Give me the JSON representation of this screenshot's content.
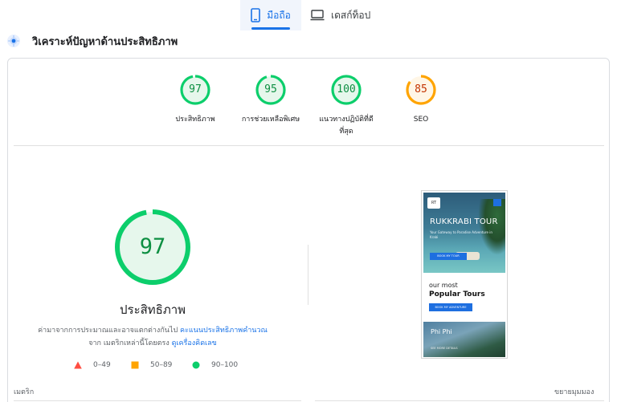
{
  "tabs": {
    "mobile": "มือถือ",
    "desktop": "เดสก์ท็อป"
  },
  "header": {
    "title": "วิเคราะห์ปัญหาด้านประสิทธิภาพ"
  },
  "scores": [
    {
      "value": 97,
      "label": "ประสิทธิภาพ",
      "color": "#0cce6b"
    },
    {
      "value": 95,
      "label": "การช่วยเหลือพิเศษ",
      "color": "#0cce6b"
    },
    {
      "value": 100,
      "label_line1": "แนวทางปฏิบัติที่ดี",
      "label_line2": "ที่สุด",
      "color": "#0cce6b"
    },
    {
      "value": 85,
      "label": "SEO",
      "color": "#ffa400"
    }
  ],
  "main": {
    "score": 97,
    "title": "ประสิทธิภาพ",
    "desc_part1": "ค่ามาจากการประมาณและอาจแตกต่างกันไป ",
    "desc_link1": "คะแนนประสิทธิภาพคำนวณ",
    "desc_part2": "จาก เมตริกเหล่านี้โดยตรง ",
    "desc_link2": "ดูเครื่องคิดเลข"
  },
  "legend": [
    {
      "range": "0–49",
      "color": "#ff4e42",
      "shape": "triangle"
    },
    {
      "range": "50–89",
      "color": "#ffa400",
      "shape": "square"
    },
    {
      "range": "90–100",
      "color": "#0cce6b",
      "shape": "circle"
    }
  ],
  "footer": {
    "metrics": "เมตริก",
    "expand": "ขยายมุมมอง"
  },
  "preview": {
    "logo_text": "RT",
    "brand": "RUKKRABI TOUR",
    "tagline": "Your Gateway to Paradise Adventure in Krabi",
    "hero_button": "BOOK MY TOUR",
    "section_sub": "our most",
    "section_title": "Popular Tours",
    "section_button": "BOOK MY ADVENTURE",
    "tile_name": "Phi Phi",
    "tile_more": "SEE MORE DETAILS"
  }
}
